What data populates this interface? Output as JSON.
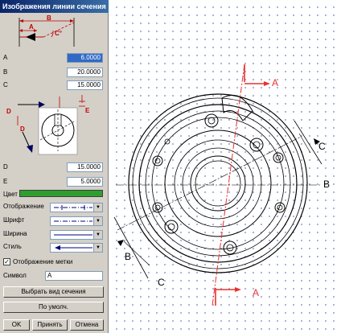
{
  "dialog": {
    "title": "Изображения линии сечения",
    "params": {
      "a_label": "A",
      "a_value": "6.0000",
      "b_label": "B",
      "b_value": "20.0000",
      "c_label": "C",
      "c_value": "15.0000",
      "d_label": "D",
      "d_value": "15.0000",
      "e_label": "E",
      "e_value": "5.0000"
    },
    "diagram1": {
      "b": "B",
      "a": "A",
      "c": "C°"
    },
    "diagram2": {
      "d": "D",
      "e": "E"
    },
    "color_label": "Цвет",
    "color_value": "#2e9e2e",
    "display_label": "Отображение",
    "font_label": "Шрифт",
    "width_label": "Ширина",
    "style_label": "Стиль",
    "show_mark_label": "Отображение метки",
    "show_mark_checked": true,
    "symbol_label": "Символ",
    "symbol_value": "A",
    "select_view_button": "Выбрать вид сечения",
    "default_button": "По умолч.",
    "ok_button": "OK",
    "apply_button": "Принять",
    "cancel_button": "Отмена"
  },
  "drawing": {
    "label_a_top": "A",
    "label_a_bottom": "A",
    "label_b_right": "B",
    "label_b_left": "B",
    "label_c_right": "C",
    "label_c_left": "C",
    "accent_color": "#e8322e",
    "grid_color": "#8e9bd8"
  }
}
